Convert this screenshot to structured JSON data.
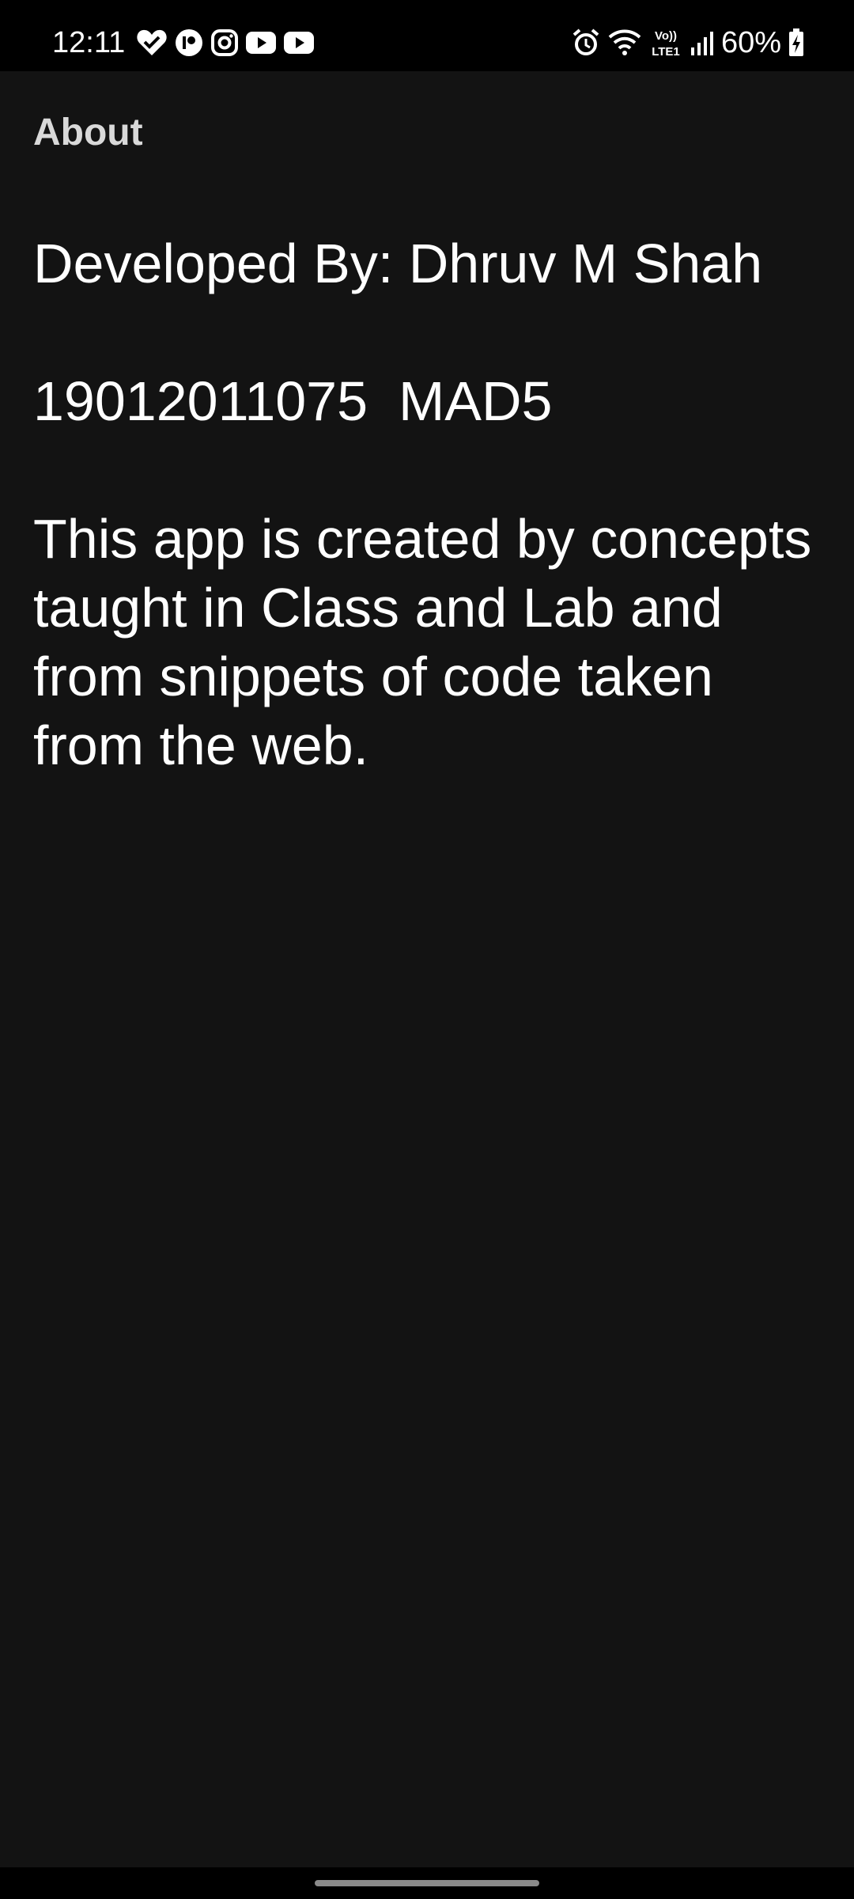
{
  "status_bar": {
    "time": "12:11",
    "left_icons": [
      "heart-check-icon",
      "tasks-icon",
      "instagram-icon",
      "youtube-icon",
      "youtube-icon"
    ],
    "right_icons": [
      "alarm-icon",
      "wifi-icon",
      "volte-icon",
      "signal-icon"
    ],
    "network_label_top": "Vo))",
    "network_label_bottom": "LTE1",
    "battery_percent": "60%"
  },
  "app_bar": {
    "title": "About"
  },
  "content": {
    "developer_line": "Developed By: Dhruv M Shah",
    "id_line": "19012011075  MAD5",
    "description": "This app is created by concepts taught in Class and Lab and from snippets of code taken from the web."
  },
  "colors": {
    "background": "#131313",
    "status_bar": "#000000",
    "title_text": "#d9d9d9",
    "body_text": "#ffffff"
  }
}
